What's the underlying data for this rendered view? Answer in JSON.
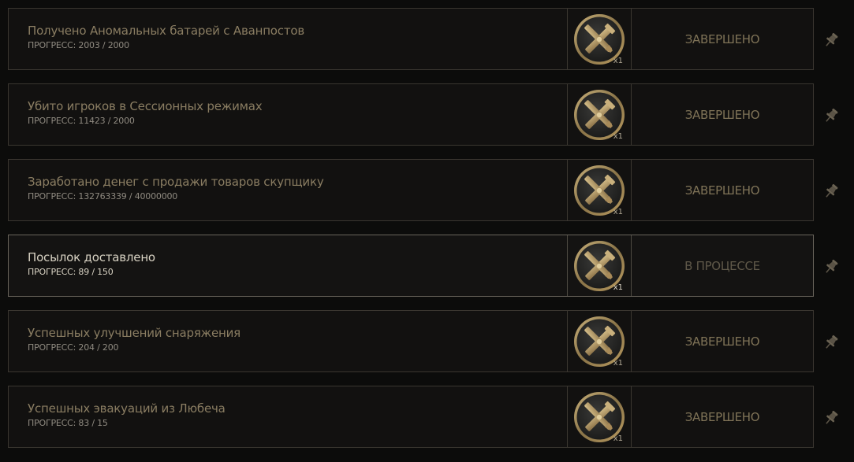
{
  "tasks": [
    {
      "title": "Получено Аномальных батарей с Аванпостов",
      "progress_text": "ПРОГРЕСС: 2003 / 2000",
      "reward_qty": "x1",
      "reward_icon": "crossed-tools-medal-icon",
      "status": "ЗАВЕРШЕНО",
      "state": "completed"
    },
    {
      "title": "Убито игроков в Сессионных режимах",
      "progress_text": "ПРОГРЕСС: 11423 / 2000",
      "reward_qty": "x1",
      "reward_icon": "crossed-tools-medal-icon",
      "status": "ЗАВЕРШЕНО",
      "state": "completed"
    },
    {
      "title": "Заработано денег с продажи товаров скупщику",
      "progress_text": "ПРОГРЕСС: 132763339 / 40000000",
      "reward_qty": "x1",
      "reward_icon": "crossed-tools-medal-icon",
      "status": "ЗАВЕРШЕНО",
      "state": "completed"
    },
    {
      "title": "Посылок доставлено",
      "progress_text": "ПРОГРЕСС: 89 / 150",
      "reward_qty": "x1",
      "reward_icon": "crossed-tools-medal-icon",
      "status": "В ПРОЦЕССЕ",
      "state": "in-progress"
    },
    {
      "title": "Успешных улучшений снаряжения",
      "progress_text": "ПРОГРЕСС: 204 / 200",
      "reward_qty": "x1",
      "reward_icon": "crossed-tools-medal-icon",
      "status": "ЗАВЕРШЕНО",
      "state": "completed"
    },
    {
      "title": "Успешных эвакуаций из Любеча",
      "progress_text": "ПРОГРЕСС: 83 / 15",
      "reward_qty": "x1",
      "reward_icon": "crossed-tools-medal-icon",
      "status": "ЗАВЕРШЕНО",
      "state": "completed"
    }
  ],
  "pin_icon": "pin-icon",
  "colors": {
    "background": "#0c0c0b",
    "completed_title": "#8a7d62",
    "active_title": "#d8d2c3",
    "completed_status": "#7f7357",
    "in_progress_status": "#5f5849",
    "medal_gold": "#b8a06a"
  }
}
